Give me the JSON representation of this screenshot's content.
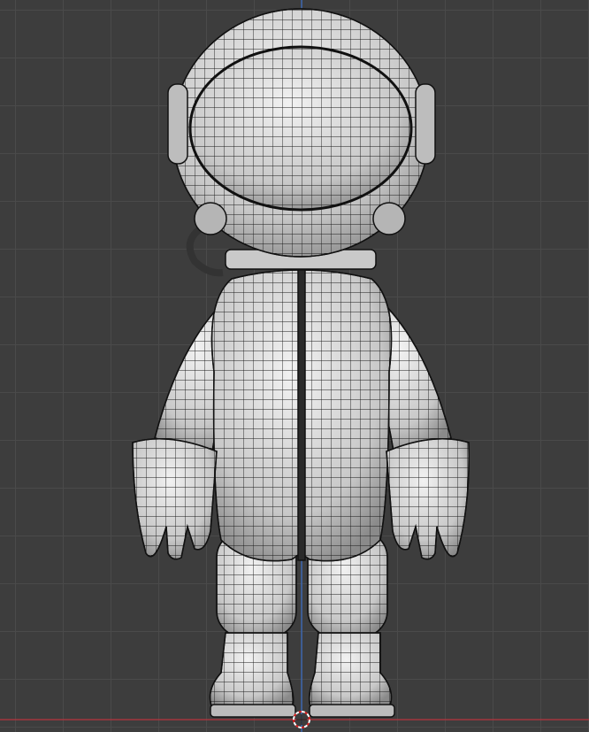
{
  "viewport": {
    "background_color": "#3d3d3d",
    "grid_color": "#4a4a4a",
    "x_axis_color": "#b8343e",
    "y_axis_color": "#3a6fc8",
    "cursor_icon": "3d-cursor-icon",
    "model": "astronaut-mesh-wireframe"
  }
}
